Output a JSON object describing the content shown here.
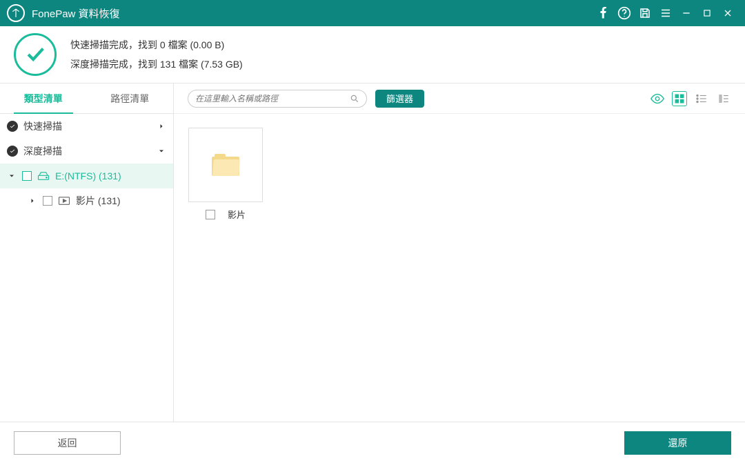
{
  "titlebar": {
    "app_name": "FonePaw 資料恢復"
  },
  "status": {
    "line1": "快速掃描完成，找到 0 檔案 (0.00  B)",
    "line2": "深度掃描完成，找到 131 檔案 (7.53 GB)"
  },
  "sidebar": {
    "tabs": {
      "type": "類型清單",
      "path": "路徑清單",
      "active": "type"
    },
    "tree": {
      "quick": "快速掃描",
      "deep": "深度掃描",
      "drive": "E:(NTFS) (131)",
      "video": "影片 (131)"
    }
  },
  "toolbar": {
    "search_placeholder": "在這里輸入名稱或路徑",
    "filter_label": "篩選器"
  },
  "grid": {
    "item0": {
      "label": "影片"
    }
  },
  "bottom": {
    "back": "返回",
    "restore": "還原"
  }
}
